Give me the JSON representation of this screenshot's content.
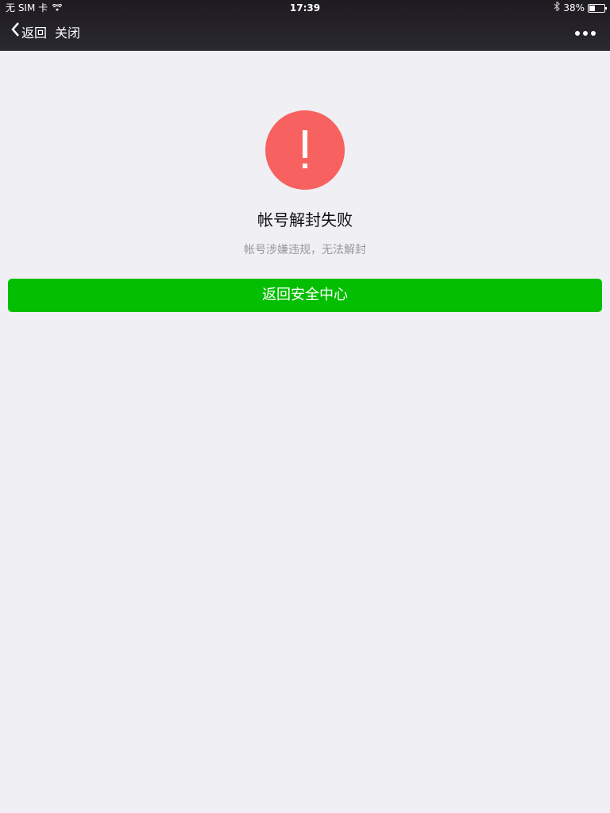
{
  "status_bar": {
    "carrier": "无 SIM 卡",
    "time": "17:39",
    "battery_percent_label": "38%",
    "battery_level": 0.38
  },
  "nav": {
    "back_label": "返回",
    "close_label": "关闭",
    "more_icon": "more-dots-icon"
  },
  "result": {
    "icon": "warning-exclamation-icon",
    "icon_color": "#f76260",
    "title": "帐号解封失败",
    "description": "帐号涉嫌违规，无法解封"
  },
  "actions": {
    "primary_label": "返回安全中心",
    "primary_color": "#04be02"
  }
}
